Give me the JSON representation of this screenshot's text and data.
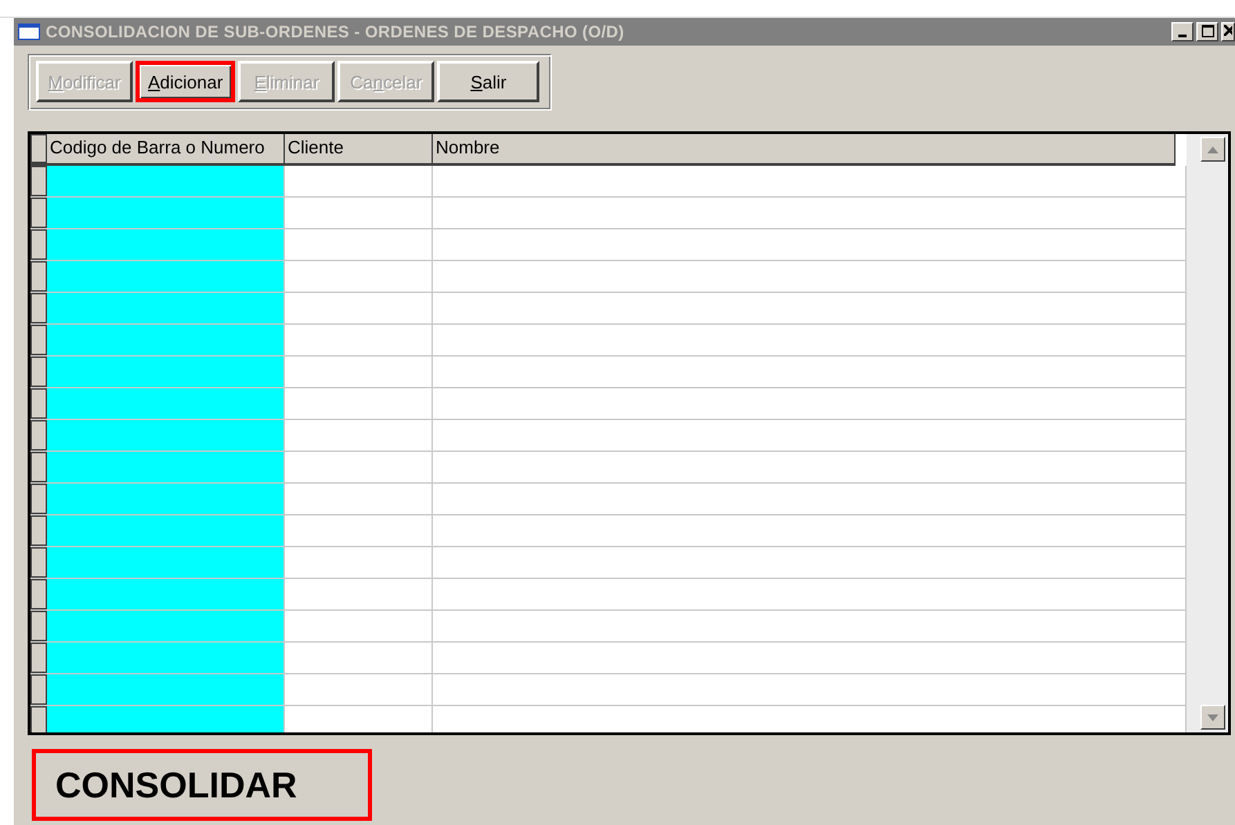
{
  "window": {
    "title": "CONSOLIDACION DE SUB-ORDENES - ORDENES DE DESPACHO (O/D)",
    "active": false
  },
  "toolbar": [
    {
      "key": "M",
      "post": "odificar",
      "disabled": true,
      "highlighted": false
    },
    {
      "key": "A",
      "post": "dicionar",
      "disabled": false,
      "highlighted": true
    },
    {
      "key": "E",
      "post": "liminar",
      "disabled": true,
      "highlighted": false
    },
    {
      "pre": "Ca",
      "key": "n",
      "post": "celar",
      "disabled": true,
      "highlighted": false
    },
    {
      "key": "S",
      "post": "alir",
      "disabled": false,
      "highlighted": false
    }
  ],
  "table": {
    "columns": [
      {
        "label": "Codigo de Barra o Numero",
        "color": "#00ffff"
      },
      {
        "label": "Cliente",
        "color": "#ffffff"
      },
      {
        "label": "Nombre",
        "color": "#ffffff"
      }
    ]
  },
  "action_button": {
    "label": "CONSOLIDAR",
    "highlighted": true
  }
}
